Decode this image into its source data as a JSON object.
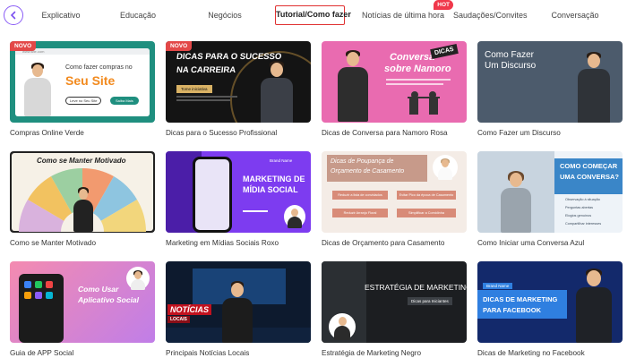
{
  "tabs": [
    {
      "label": "Explicativo"
    },
    {
      "label": "Educação"
    },
    {
      "label": "Negócios"
    },
    {
      "label": "Tutorial/Como fazer"
    },
    {
      "label": "Notícias de última hora"
    },
    {
      "label": "Saudações/Convites"
    },
    {
      "label": "Conversação"
    }
  ],
  "hot_badge": "HOT",
  "novo_badge": "NOVO",
  "colors": {
    "accent": "#8a5cf6",
    "active_border": "#e03131",
    "hot": "#f0384b"
  },
  "cards": [
    {
      "caption": "Compras Online Verde",
      "thumb": {
        "url": "www.site.com",
        "line1": "Como fazer compras no",
        "line2": "Seu Site",
        "btn1": "Leve no Seu Site",
        "btn2": "Saiba Mais"
      }
    },
    {
      "caption": "Dicas para o Sucesso Profissional",
      "thumb": {
        "line1": "DICAS PARA O SUCESSO",
        "line2": "NA CARREIRA",
        "tag": "Tome iniciativa"
      }
    },
    {
      "caption": "Dicas de Conversa para Namoro Rosa",
      "thumb": {
        "line1": "Conversa",
        "line2": "sobre Namoro",
        "tag": "DICAS"
      }
    },
    {
      "caption": "Como Fazer um Discurso",
      "thumb": {
        "line1": "Como Fazer",
        "line2": "Um Discurso"
      }
    },
    {
      "caption": "Como se Manter Motivado",
      "thumb": {
        "line1": "Como se Manter Motivado"
      }
    },
    {
      "caption": "Marketing em Mídias Sociais Roxo",
      "thumb": {
        "brand": "Brand Name",
        "line1": "MARKETING DE",
        "line2": "MÍDIA SOCIAL"
      }
    },
    {
      "caption": "Dicas de Orçamento para Casamento",
      "thumb": {
        "line1": "Dicas de Poupança de",
        "line2": "Orçamento de Casamento",
        "b1": "Reduzir a lista de convidados",
        "b2": "Evitar Pico da época de Casamento",
        "b3": "Reduzir Arranjo Floral",
        "b4": "Simplificar a Comidinha"
      }
    },
    {
      "caption": "Como Iniciar uma Conversa Azul",
      "thumb": {
        "line1": "COMO COMEÇAR",
        "line2": "UMA CONVERSA?",
        "i1": "Observação à situação",
        "i2": "Perguntas abertas",
        "i3": "Elogios genuínos",
        "i4": "Compartilhar interesses"
      }
    },
    {
      "caption": "Guia de APP Social",
      "thumb": {
        "line1": "Como Usar",
        "line2": "Aplicativo Social"
      }
    },
    {
      "caption": "Principais Notícias Locais",
      "thumb": {
        "line1": "NOTÍCIAS",
        "line2": "LOCAIS"
      }
    },
    {
      "caption": "Estratégia de Marketing Negro",
      "thumb": {
        "line1": "ESTRATÉGIA DE MARKETING",
        "tag": "Dicas para Iniciantes"
      }
    },
    {
      "caption": "Dicas de Marketing no Facebook",
      "thumb": {
        "brand": "Brand Name",
        "line1": "DICAS DE MARKETING",
        "line2": "PARA FACEBOOK"
      }
    }
  ]
}
